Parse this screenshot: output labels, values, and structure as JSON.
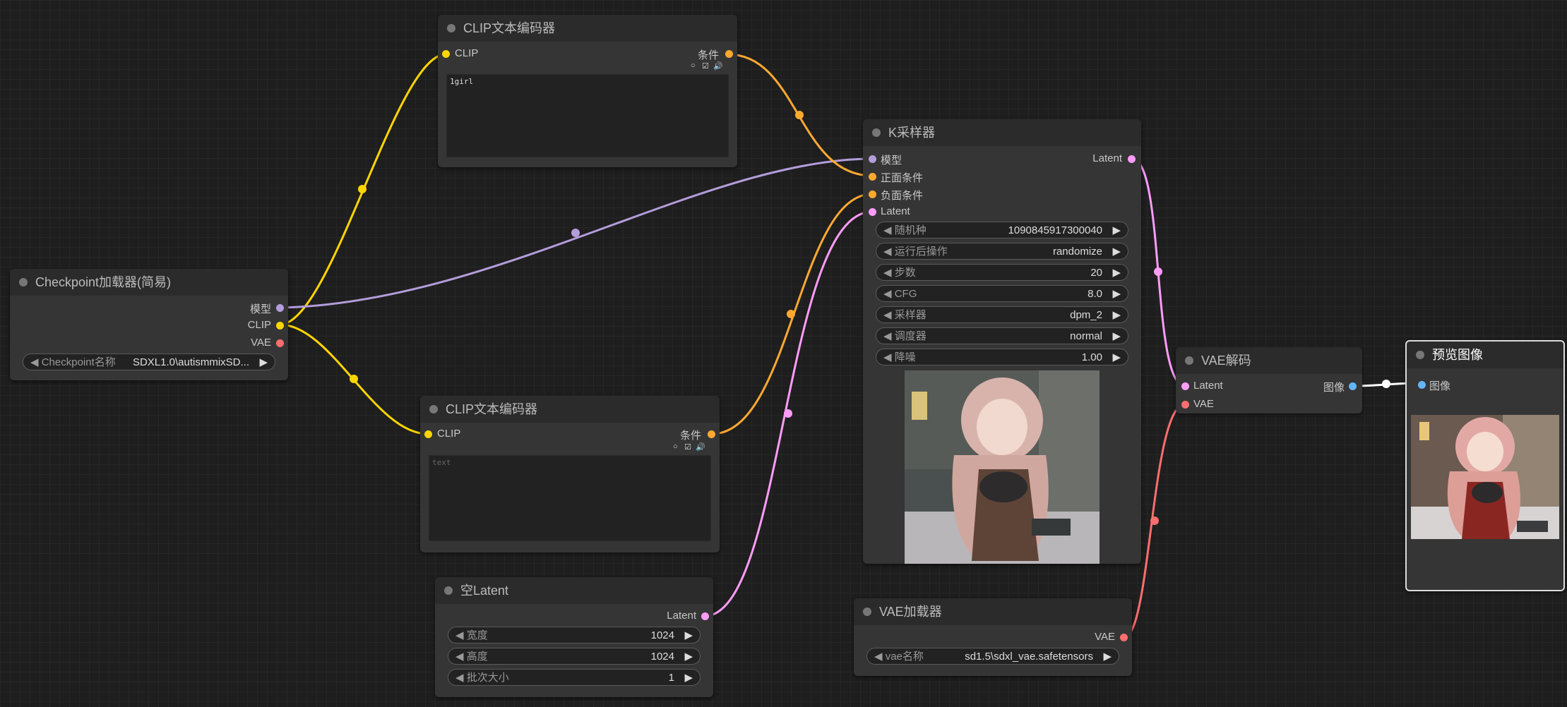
{
  "colors": {
    "clip": "#ffd500",
    "model": "#b39ddb",
    "conditioning": "#ffa931",
    "latent": "#ff9cf9",
    "vae": "#ff6e6e",
    "image": "#64b5f6",
    "link_white": "#ffffff"
  },
  "icons": {
    "circle": "○",
    "check": "☑",
    "speaker": "🔊",
    "left": "◀",
    "right": "▶"
  },
  "clip_pos": {
    "title": "CLIP文本编码器",
    "in_clip": "CLIP",
    "out_cond": "条件",
    "text": "1girl"
  },
  "clip_neg": {
    "title": "CLIP文本编码器",
    "in_clip": "CLIP",
    "out_cond": "条件",
    "placeholder": "text"
  },
  "checkpoint": {
    "title": "Checkpoint加载器(简易)",
    "out_model": "模型",
    "out_clip": "CLIP",
    "out_vae": "VAE",
    "w_label": "Checkpoint名称",
    "w_value": "SDXL1.0\\autismmixSD..."
  },
  "ksampler": {
    "title": "K采样器",
    "in_model": "模型",
    "in_pos": "正面条件",
    "in_neg": "负面条件",
    "in_latent": "Latent",
    "out_latent": "Latent",
    "widgets": [
      {
        "label": "随机种",
        "value": "1090845917300040"
      },
      {
        "label": "运行后操作",
        "value": "randomize"
      },
      {
        "label": "步数",
        "value": "20"
      },
      {
        "label": "CFG",
        "value": "8.0"
      },
      {
        "label": "采样器",
        "value": "dpm_2"
      },
      {
        "label": "调度器",
        "value": "normal"
      },
      {
        "label": "降噪",
        "value": "1.00"
      }
    ]
  },
  "empty_latent": {
    "title": "空Latent",
    "out_latent": "Latent",
    "widgets": [
      {
        "label": "宽度",
        "value": "1024"
      },
      {
        "label": "高度",
        "value": "1024"
      },
      {
        "label": "批次大小",
        "value": "1"
      }
    ]
  },
  "vae_decode": {
    "title": "VAE解码",
    "in_latent": "Latent",
    "in_vae": "VAE",
    "out_image": "图像"
  },
  "vae_loader": {
    "title": "VAE加载器",
    "out_vae": "VAE",
    "w_label": "vae名称",
    "w_value": "sd1.5\\sdxl_vae.safetensors"
  },
  "preview": {
    "title": "预览图像",
    "in_image": "图像"
  }
}
